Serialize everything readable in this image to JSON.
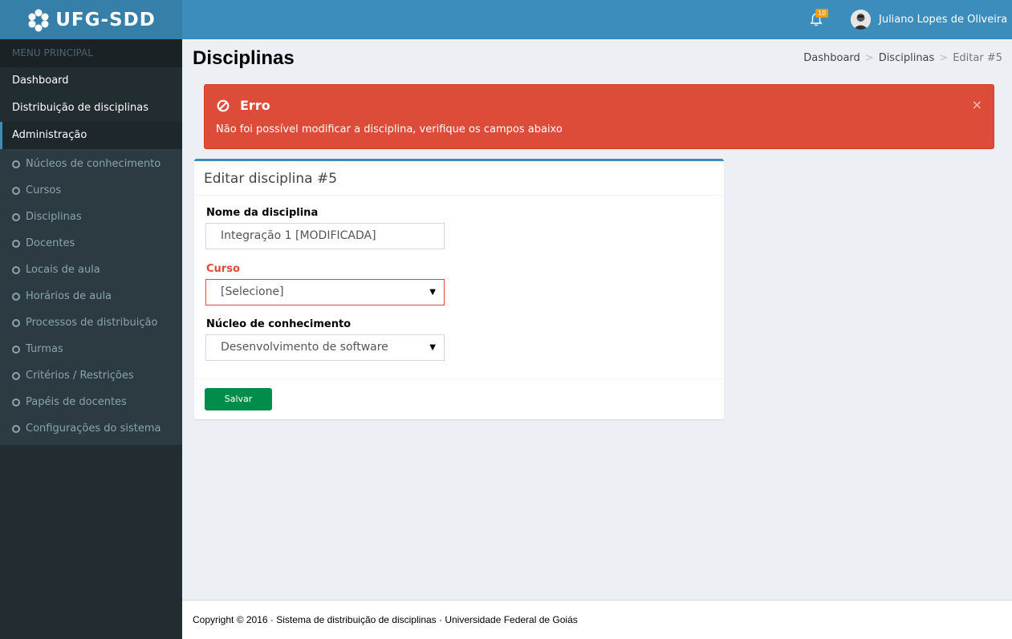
{
  "app": {
    "logo_text": "UFG-SDD"
  },
  "header": {
    "notifications_count": "10",
    "user_name": "Juliano Lopes de Oliveira"
  },
  "sidebar": {
    "menu_header": "MENU PRINCIPAL",
    "items": [
      {
        "label": "Dashboard"
      },
      {
        "label": "Distribuição de disciplinas"
      },
      {
        "label": "Administração"
      }
    ],
    "subitems": [
      {
        "label": "Núcleos de conhecimento"
      },
      {
        "label": "Cursos"
      },
      {
        "label": "Disciplinas"
      },
      {
        "label": "Docentes"
      },
      {
        "label": "Locais de aula"
      },
      {
        "label": "Horários de aula"
      },
      {
        "label": "Processos de distribuição"
      },
      {
        "label": "Turmas"
      },
      {
        "label": "Critérios / Restrições"
      },
      {
        "label": "Papéis de docentes"
      },
      {
        "label": "Configurações do sistema"
      }
    ]
  },
  "page": {
    "title": "Disciplinas",
    "breadcrumb": [
      "Dashboard",
      "Disciplinas",
      "Editar #5"
    ],
    "breadcrumb_sep": ">"
  },
  "alert": {
    "title": "Erro",
    "message": "Não foi possível modificar a disciplina, verifique os campos abaixo",
    "close": "×",
    "color": "#dd4b39"
  },
  "form": {
    "title": "Editar disciplina #5",
    "name_label": "Nome da disciplina",
    "name_value": "Integração 1 [MODIFICADA]",
    "course_label": "Curso",
    "course_value": "[Selecione]",
    "nucleus_label": "Núcleo de conhecimento",
    "nucleus_value": "Desenvolvimento de software",
    "save_label": "Salvar"
  },
  "footer": {
    "text": "Copyright © 2016 · Sistema de distribuição de disciplinas · Universidade Federal de Goiás"
  },
  "colors": {
    "primary": "#3c8dbc",
    "sidebar": "#222d32",
    "success": "#008d4c",
    "danger": "#dd4b39"
  }
}
